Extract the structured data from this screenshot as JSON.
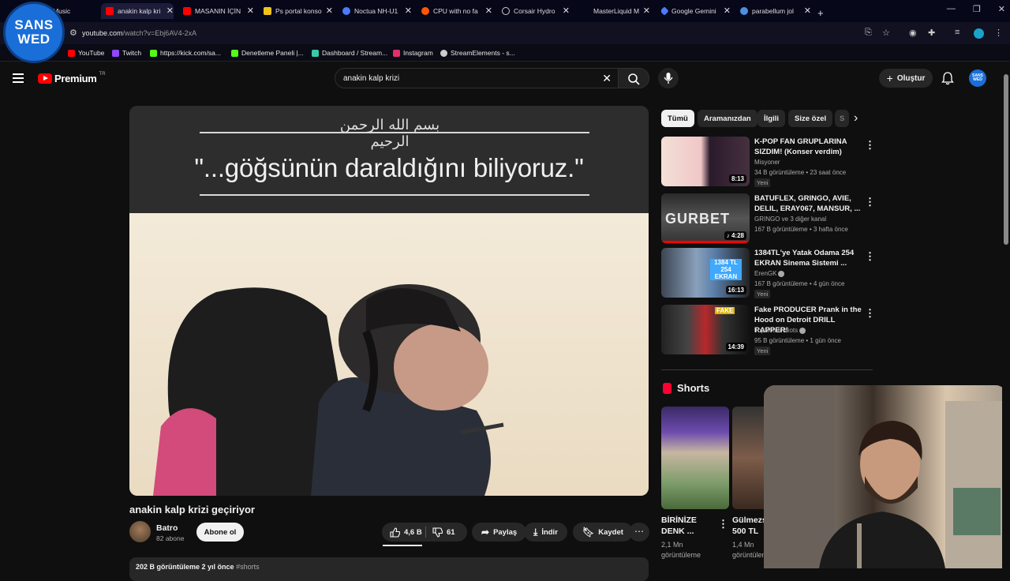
{
  "browser": {
    "tabs": [
      {
        "label": "e Music",
        "color": "#ff0000"
      },
      {
        "label": "anakin kalp kri",
        "color": "#ff0000"
      },
      {
        "label": "MASANIN İÇİN",
        "color": "#ff0000"
      },
      {
        "label": "Ps portal konso",
        "color": "#f0c419"
      },
      {
        "label": "Noctua NH-U1",
        "color": "#4a7cff"
      },
      {
        "label": "CPU with no fa",
        "color": "#ff5700"
      },
      {
        "label": "Corsair Hydro",
        "color": "#999999"
      },
      {
        "label": "MasterLiquid M",
        "color": "#6a6a8a"
      },
      {
        "label": "Google Gemini",
        "color": "#4a7cff"
      },
      {
        "label": "parabellum jol",
        "color": "#4a90e2"
      }
    ],
    "new_tab": "+",
    "url_host": "youtube.com",
    "url_path": "/watch?v=Ebj6AV4-2xA",
    "bookmarks": [
      {
        "label": "YouTube",
        "color": "#ff0000"
      },
      {
        "label": "Twitch",
        "color": "#9146ff"
      },
      {
        "label": "https://kick.com/sa...",
        "color": "#53fc18"
      },
      {
        "label": "Denetleme Paneli |...",
        "color": "#53fc18"
      },
      {
        "label": "Dashboard / Stream...",
        "color": "#38c9a8"
      },
      {
        "label": "Instagram",
        "color": "#e1306c"
      },
      {
        "label": "StreamElements - s...",
        "color": "#cccccc"
      }
    ]
  },
  "overlay_logo": {
    "line1": "SANS",
    "line2": "WED"
  },
  "youtube": {
    "logo_text": "Premium",
    "logo_region": "TR",
    "search_query": "anakin kalp krizi",
    "create_label": "Oluştur",
    "avatar_text": "SANS WED"
  },
  "video": {
    "caption": "\"...göğsünün daraldığını biliyoruz.\"",
    "basmala": "بسم الله الرحمن الرحيم",
    "title": "anakin kalp krizi geçiriyor",
    "channel": "Batro",
    "subscribers": "82 abone",
    "subscribe_label": "Abone ol",
    "likes": "4,6 B",
    "dislikes": "61",
    "share_label": "Paylaş",
    "download_label": "İndir",
    "save_label": "Kaydet",
    "description_stats": "202 B görüntüleme  2 yıl önce",
    "description_tag": "#shorts"
  },
  "chips": [
    "Tümü",
    "Aramanızdan",
    "İlgili",
    "Size özel",
    "S"
  ],
  "related": [
    {
      "title": "K-POP FAN GRUPLARINA SIZDIM! (Konser verdim)",
      "channel": "Misyoner",
      "verified": false,
      "stats": "34 B görüntüleme • 23 saat önce",
      "badge": "Yeni",
      "duration": "8:13"
    },
    {
      "title": "BATUFLEX, GRINGO, AVIE, DELIL, ERAY067, MANSUR, ...",
      "channel": "GRINGO ve 3 diğer kanal",
      "verified": false,
      "stats": "167 B görüntüleme • 3 hafta önce",
      "badge": "",
      "duration": "4:28",
      "thumb_text": "GURBET"
    },
    {
      "title": "1384TL'ye Yatak Odama 254 EKRAN Sinema Sistemi ...",
      "channel": "ErenGK",
      "verified": true,
      "stats": "167 B görüntüleme • 4 gün önce",
      "badge": "Yeni",
      "duration": "16:13",
      "thumb_text": "1384 TL 254 EKRAN"
    },
    {
      "title": "Fake PRODUCER Prank in the Hood on Detroit DRILL RAPPER!",
      "channel": "TopNotch Idiots",
      "verified": true,
      "stats": "95 B görüntüleme • 1 gün önce",
      "badge": "Yeni",
      "duration": "14:39",
      "thumb_text": "FAKE"
    }
  ],
  "shorts": {
    "heading": "Shorts",
    "items": [
      {
        "title": "BİRİNİZE DENK ...",
        "views": "2,1 Mn görüntüleme"
      },
      {
        "title": "Gülmezs 500 TL",
        "views": "1,4 Mn görüntüleme"
      }
    ]
  }
}
